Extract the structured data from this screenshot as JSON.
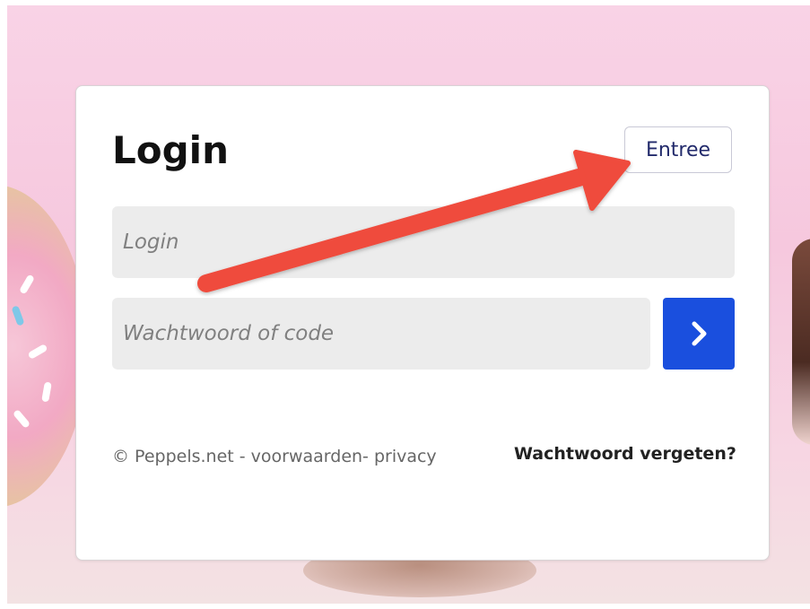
{
  "login_card": {
    "title": "Login",
    "entree_label": "Entree",
    "login_placeholder": "Login",
    "password_placeholder": "Wachtwoord of code",
    "submit_icon": "chevron-right-icon",
    "footer_text": "© Peppels.net - voorwaarden- privacy",
    "forgot_password": "Wachtwoord vergeten?"
  },
  "annotation": {
    "arrow_icon": "arrow-annotation",
    "color": "#ef4c3c"
  },
  "colors": {
    "primary_button": "#1a4fde",
    "entree_text": "#222a6b",
    "input_background": "#ececec",
    "background": "#f7cfe2"
  }
}
